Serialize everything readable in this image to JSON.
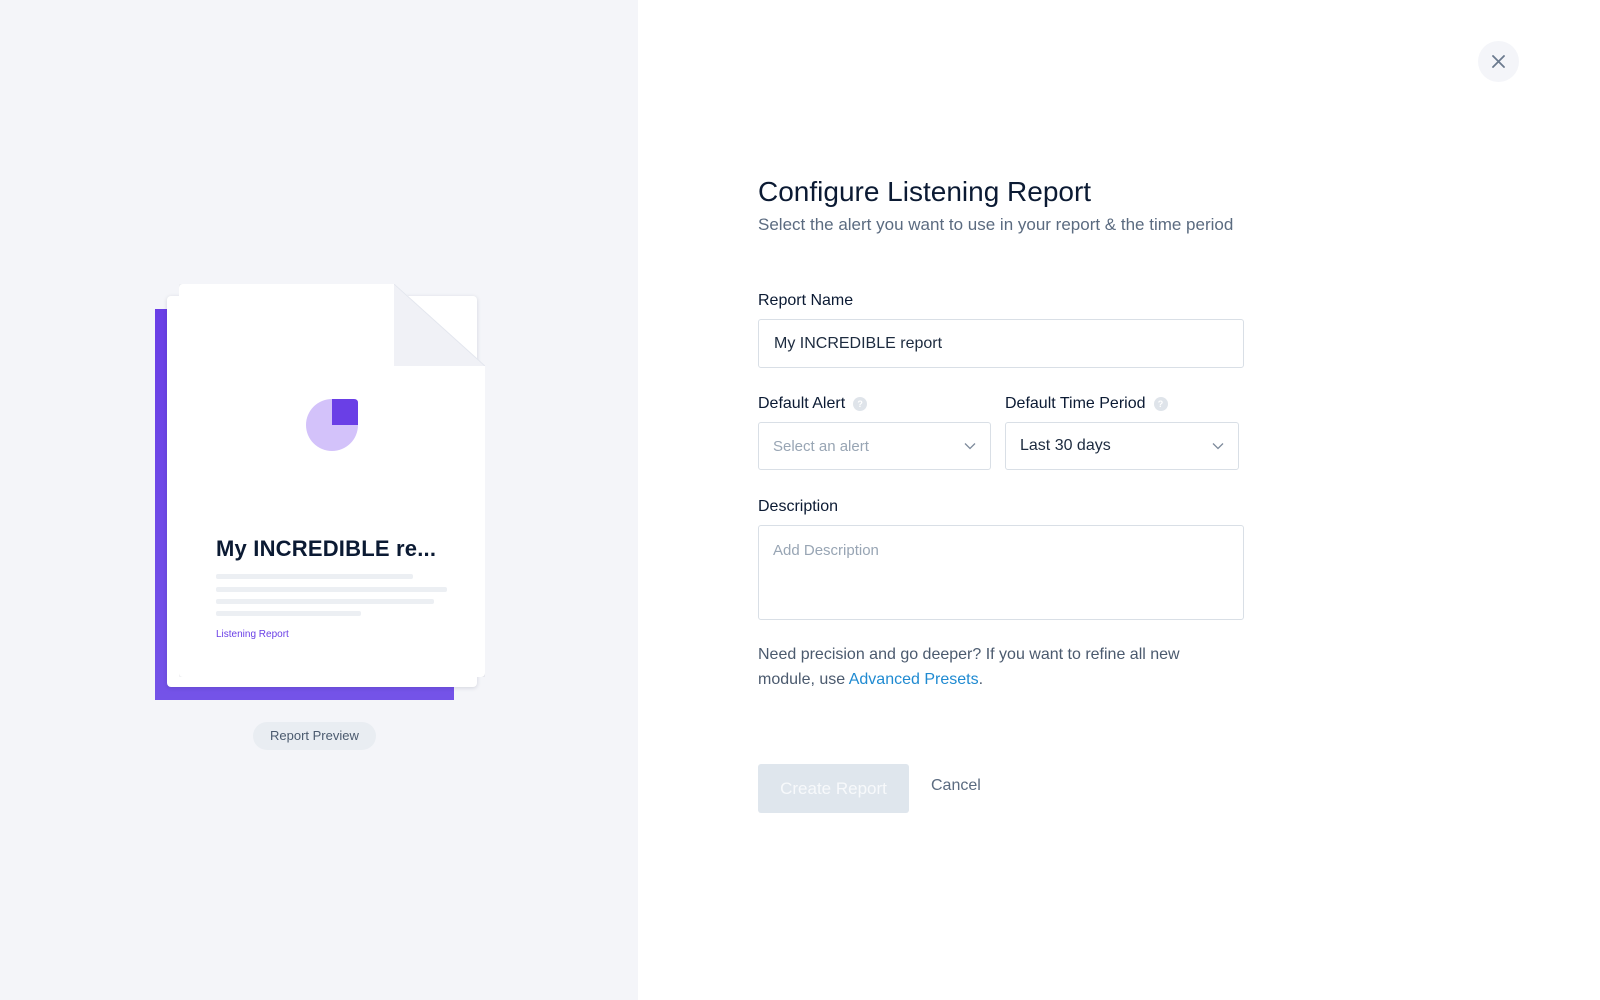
{
  "preview": {
    "doc_title": "My INCREDIBLE re...",
    "doc_tag": "Listening Report",
    "badge_label": "Report Preview",
    "accent_color": "#6a3fe6",
    "accent_light_color": "#d3c2fa",
    "icon": "pie-chart-icon"
  },
  "header": {
    "close_icon": "close-icon",
    "title": "Configure Listening Report",
    "subtitle": "Select the alert you want to use in your report & the time period"
  },
  "form": {
    "report_name": {
      "label": "Report Name",
      "value": "My INCREDIBLE report"
    },
    "default_alert": {
      "label": "Default Alert",
      "help_icon": "question-mark-icon",
      "placeholder": "Select an alert",
      "value": ""
    },
    "default_time_period": {
      "label": "Default Time Period",
      "help_icon": "question-mark-icon",
      "value": "Last 30 days"
    },
    "description": {
      "label": "Description",
      "placeholder": "Add Description",
      "value": ""
    },
    "help_text_prefix": "Need precision and go deeper? If you want to refine all new module, use ",
    "help_link": "Advanced Presets",
    "help_text_suffix": ".",
    "link_color": "#1f8ad1"
  },
  "actions": {
    "create_label": "Create Report",
    "create_disabled": true,
    "cancel_label": "Cancel"
  }
}
